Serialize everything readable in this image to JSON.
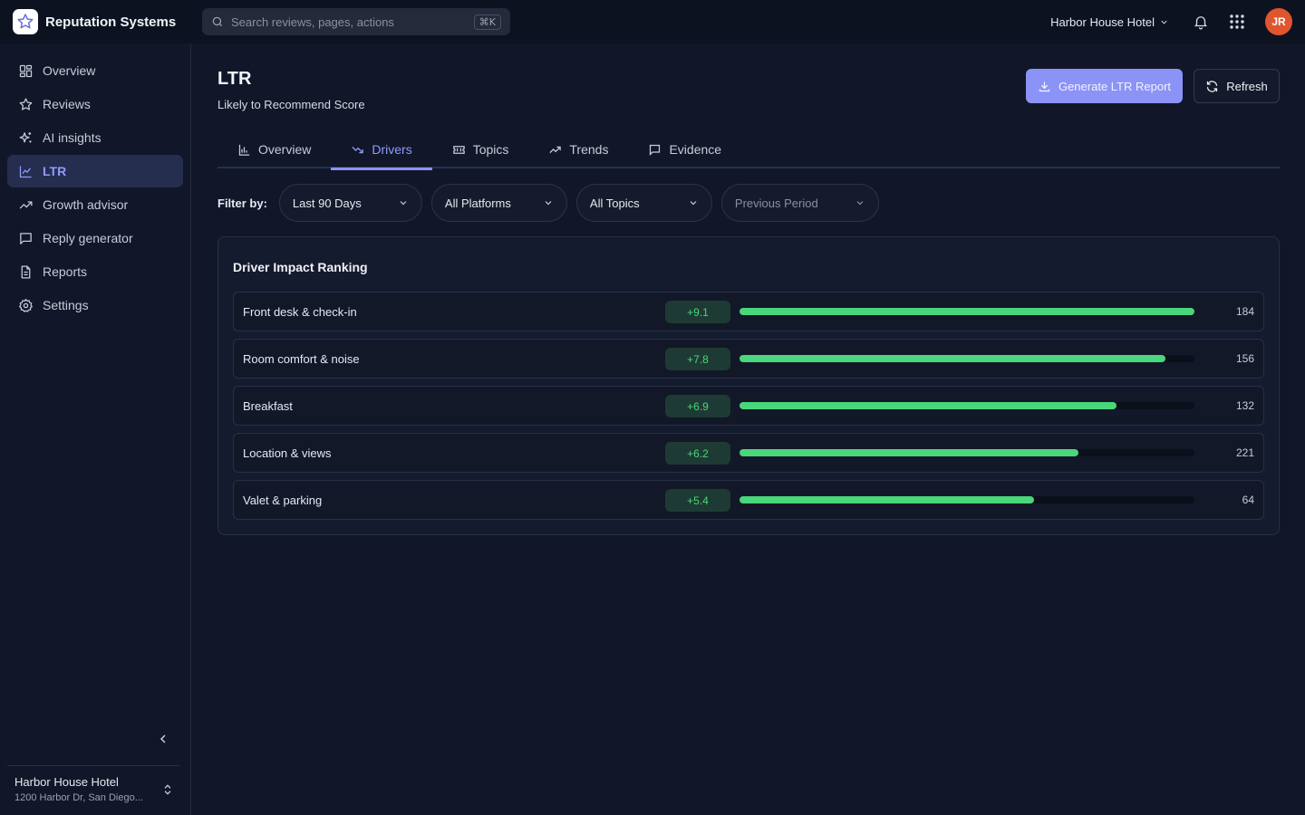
{
  "app": {
    "name": "Reputation Systems"
  },
  "search": {
    "placeholder": "Search reviews, pages, actions",
    "shortcut": "⌘K"
  },
  "header": {
    "hotel": "Harbor House Hotel",
    "avatar_initials": "JR",
    "avatar_color": "#e0552e"
  },
  "sidebar": {
    "items": [
      {
        "label": "Overview",
        "icon": "grid-icon"
      },
      {
        "label": "Reviews",
        "icon": "star-icon"
      },
      {
        "label": "AI insights",
        "icon": "sparkle-icon"
      },
      {
        "label": "LTR",
        "icon": "line-chart-icon",
        "active": true
      },
      {
        "label": "Growth advisor",
        "icon": "trend-up-icon"
      },
      {
        "label": "Reply generator",
        "icon": "message-icon"
      },
      {
        "label": "Reports",
        "icon": "document-icon"
      },
      {
        "label": "Settings",
        "icon": "gear-icon"
      }
    ],
    "footer": {
      "hotel_name": "Harbor House Hotel",
      "address": "1200 Harbor Dr, San Diego..."
    }
  },
  "page": {
    "title": "LTR",
    "subtitle": "Likely to Recommend Score",
    "primary_button": "Generate LTR Report",
    "secondary_button": "Refresh"
  },
  "tabs": [
    {
      "label": "Overview",
      "icon": "bar-chart-icon"
    },
    {
      "label": "Drivers",
      "icon": "trend-down-icon",
      "active": true
    },
    {
      "label": "Topics",
      "icon": "ticket-icon"
    },
    {
      "label": "Trends",
      "icon": "trend-up-icon"
    },
    {
      "label": "Evidence",
      "icon": "message-icon"
    }
  ],
  "filters": {
    "label": "Filter by:",
    "period": "Last 90 Days",
    "platform": "All Platforms",
    "topic": "All Topics",
    "comparison": "Previous Period"
  },
  "drivers": {
    "title": "Driver Impact Ranking",
    "accent_color": "#4ad67a",
    "rows": [
      {
        "label": "Front desk & check-in",
        "impact": "+9.1",
        "fill_percent": 100,
        "count": "184"
      },
      {
        "label": "Room comfort & noise",
        "impact": "+7.8",
        "fill_percent": 93.6,
        "count": "156"
      },
      {
        "label": "Breakfast",
        "impact": "+6.9",
        "fill_percent": 82.9,
        "count": "132"
      },
      {
        "label": "Location & views",
        "impact": "+6.2",
        "fill_percent": 74.5,
        "count": "221"
      },
      {
        "label": "Valet & parking",
        "impact": "+5.4",
        "fill_percent": 64.7,
        "count": "64"
      }
    ]
  }
}
